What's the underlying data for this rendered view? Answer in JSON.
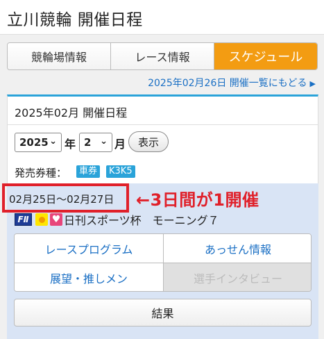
{
  "header": {
    "title": "立川競輪 開催日程"
  },
  "tabs": [
    {
      "label": "競輪場情報",
      "active": false
    },
    {
      "label": "レース情報",
      "active": false
    },
    {
      "label": "スケジュール",
      "active": true
    }
  ],
  "back_link": {
    "label": "2025年02月26日 開催一覧にもどる",
    "icon": "triangle-right-icon"
  },
  "schedule": {
    "title": "2025年02月 開催日程",
    "year_select": {
      "value": "2025",
      "unit": "年"
    },
    "month_select": {
      "value": "2",
      "unit": "月"
    },
    "show_button": "表示",
    "ticket_label": "発売券種：",
    "ticket_badges": [
      "車券",
      "K3K5"
    ]
  },
  "race": {
    "dates": "02月25日〜02月27日",
    "annotation": "←3日間が1開催",
    "grade": "FⅡ",
    "name": "日刊スポーツ杯　モーニング７",
    "buttons": [
      {
        "label": "レースプログラム",
        "disabled": false
      },
      {
        "label": "あっせん情報",
        "disabled": false
      },
      {
        "label": "展望・推しメン",
        "disabled": false
      },
      {
        "label": "選手インタビュー",
        "disabled": true
      }
    ],
    "result_button": "結果"
  },
  "colors": {
    "accent": "#f39c12",
    "link": "#1a6fc4",
    "annotation_red": "#e0202a",
    "panel_border": "#2aa3d9",
    "race_bg": "#d9e4f5"
  }
}
